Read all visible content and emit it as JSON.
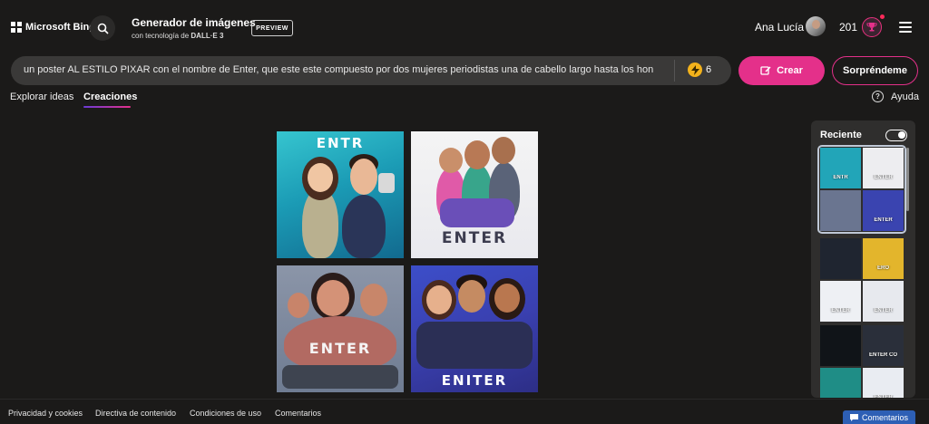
{
  "header": {
    "brand": "Microsoft Bing",
    "title": "Generador de imágenes",
    "subtitle_prefix": "con tecnología de ",
    "subtitle_model": "DALL·E 3",
    "preview_badge": "PREVIEW",
    "user_name": "Ana Lucía",
    "points": "201"
  },
  "prompt": {
    "text": "un poster AL ESTILO PIXAR con el nombre de Enter, que este este compuesto por  dos mujeres periodistas una de cabello largo hasta los hon",
    "boosts": "6"
  },
  "buttons": {
    "create": "Crear",
    "surprise": "Sorpréndeme"
  },
  "tabs": [
    {
      "label": "Explorar ideas",
      "active": false
    },
    {
      "label": "Creaciones",
      "active": true
    }
  ],
  "help_label": "Ayuda",
  "images": [
    {
      "title_text": "ENTR"
    },
    {
      "title_text": "ENTER"
    },
    {
      "title_text": "ENTER"
    },
    {
      "title_text": "ENITER"
    }
  ],
  "recent": {
    "title": "Reciente",
    "toggle_on": true,
    "groups": [
      {
        "thumbs": [
          "ENTR",
          "ENTER",
          "",
          "ENTER"
        ]
      },
      {
        "thumbs": [
          "",
          "ERO",
          "ENTER",
          "ENTER"
        ]
      },
      {
        "thumbs": [
          "",
          "ENTER CO",
          "",
          "ENTER"
        ]
      }
    ]
  },
  "footer": {
    "links": [
      "Privacidad y cookies",
      "Directiva de contenido",
      "Condiciones de uso",
      "Comentarios"
    ],
    "feedback": "Comentarios"
  },
  "colors": {
    "accent": "#e4308a",
    "background": "#1b1a19",
    "prompt_bg": "#3a3938",
    "panel_bg": "#2f2e2d"
  },
  "icons": [
    "windows-logo-icon",
    "search-icon",
    "trophy-icon",
    "hamburger-menu-icon",
    "boost-icon",
    "create-icon",
    "help-icon",
    "feedback-icon"
  ]
}
